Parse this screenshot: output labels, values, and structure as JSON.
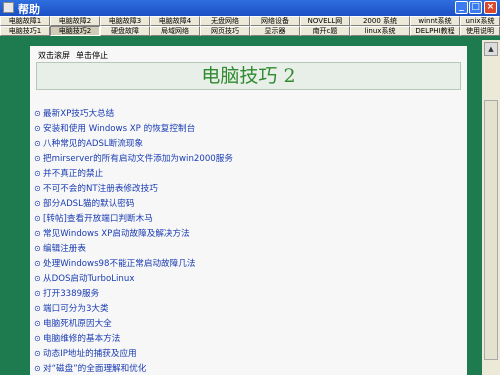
{
  "window": {
    "title": "帮助"
  },
  "menu_row1": [
    "电脑故障1",
    "电脑故障2",
    "电脑故障3",
    "电脑故障4",
    "无盘网络",
    "网络设备",
    "NOVELL网",
    "2000 系统",
    "winnt系统",
    "unix系统"
  ],
  "menu_row2": [
    "电脑技巧1",
    "电脑技巧2",
    "硬盘故障",
    "局域网络",
    "网页技巧",
    "显示器",
    "南开c题",
    "linux系统",
    "DELPHI教程",
    "使用说明"
  ],
  "active_tab": "电脑技巧2",
  "controls": {
    "pause": "双击滚屏",
    "stop": "单击停止"
  },
  "page_title": "电脑技巧 2",
  "bullet_icon": "circle-dot-icon",
  "articles": [
    "最新XP技巧大总结",
    "安装和使用 Windows XP 的恢复控制台",
    "八种常见的ADSL断流现象",
    "把mirserver的所有启动文件添加为win2000服务",
    "并不真正的禁止",
    "不可不会的NT注册表修改技巧",
    "部分ADSL猫的默认密码",
    "[转帖]查看开放端口判断木马",
    "常见Windows XP启动故障及解决方法",
    "编辑注册表",
    "处理Windows98不能正常启动故障几法",
    "从DOS启动TurboLinux",
    "打开3389服务",
    "端口可分为3大类",
    "电脑死机原因大全",
    "电脑维修的基本方法",
    "动态IP地址的捕获及应用",
    "对“磁盘”的全面理解和优化"
  ]
}
